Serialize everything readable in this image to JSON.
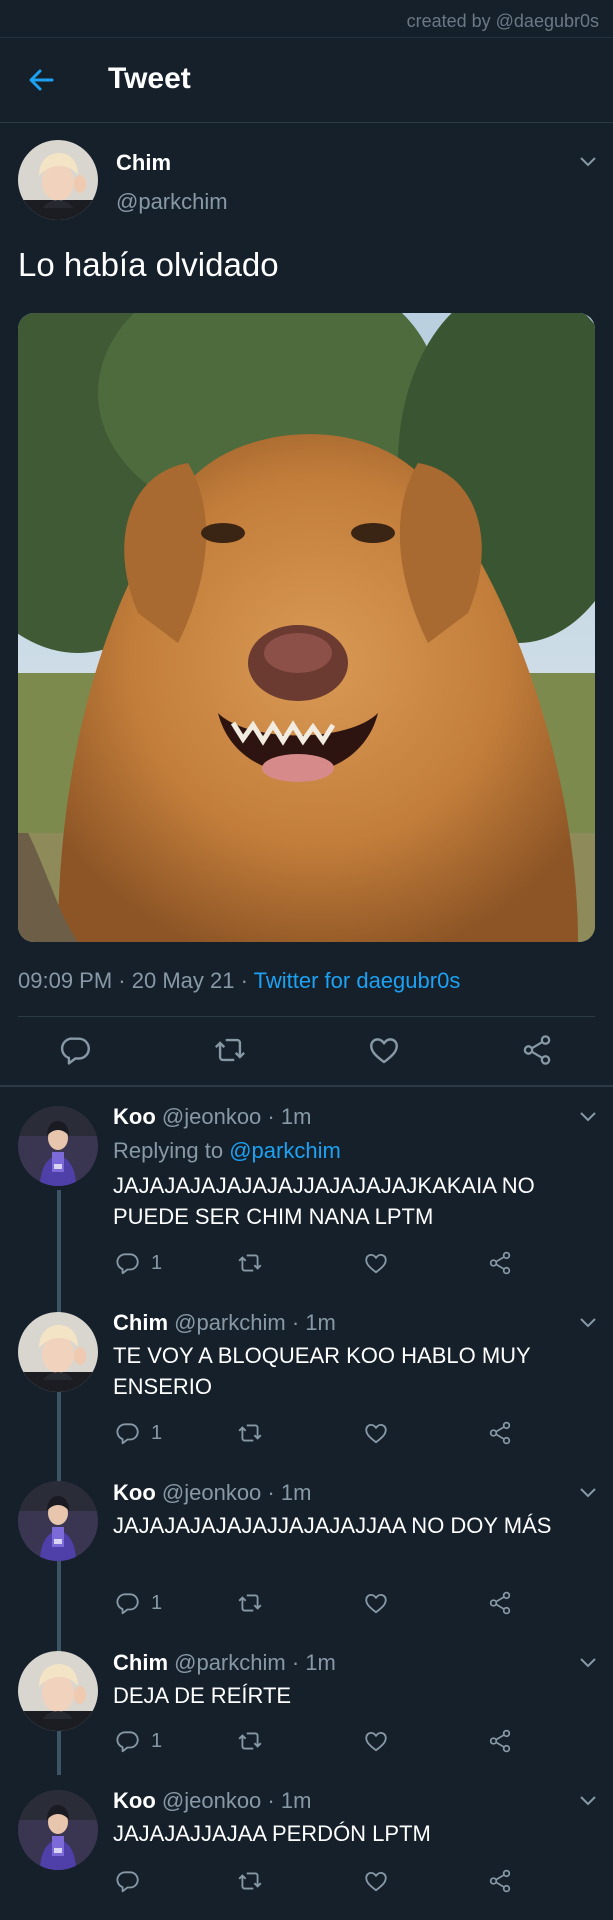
{
  "credit": "created by @daegubr0s",
  "header": {
    "title": "Tweet"
  },
  "main_tweet": {
    "name": "Chim",
    "handle": "@parkchim",
    "text": "Lo había olvidado",
    "time": "09:09 PM",
    "date": "20 May 21",
    "source": "Twitter for daegubr0s"
  },
  "replies": [
    {
      "name": "Koo",
      "handle": "@jeonkoo",
      "time": "1m",
      "replying_prefix": "Replying to",
      "replying_to": "@parkchim",
      "text": "JAJAJAJAJAJAJAJJAJAJAJAJKAKAIA NO PUEDE SER CHIM NANA LPTM",
      "reply_count": "1"
    },
    {
      "name": "Chim",
      "handle": "@parkchim",
      "time": "1m",
      "text": "TE VOY A BLOQUEAR KOO HABLO MUY ENSERIO",
      "reply_count": "1"
    },
    {
      "name": "Koo",
      "handle": "@jeonkoo",
      "time": "1m",
      "text": "JAJAJAJAJAJAJJAJAJAJJAA NO DOY MÁS",
      "reply_count": "1"
    },
    {
      "name": "Chim",
      "handle": "@parkchim",
      "time": "1m",
      "text": "DEJA DE REÍRTE",
      "reply_count": "1"
    },
    {
      "name": "Koo",
      "handle": "@jeonkoo",
      "time": "1m",
      "text": "JAJAJAJJAJAA PERDÓN LPTM",
      "reply_count": ""
    }
  ],
  "colors": {
    "background": "#15202b",
    "accent": "#1da1f2",
    "muted": "#8899a6",
    "divider": "#2b3945"
  },
  "icons": [
    "back-arrow-icon",
    "chevron-down-icon",
    "reply-icon",
    "retweet-icon",
    "like-icon",
    "share-icon"
  ]
}
